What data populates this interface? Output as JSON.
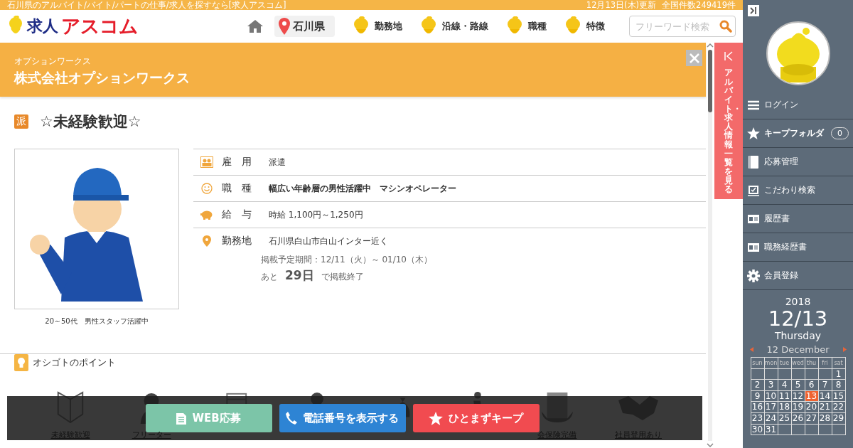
{
  "top_bar": {
    "tagline": "石川県のアルバイト/バイト/パートの仕事/求人を探すなら[求人アスコム]",
    "updated": "12月13日(木)更新",
    "total": "全国件数249419件"
  },
  "header": {
    "logo_kanji": "求人",
    "logo_kana": "アスコム",
    "prefecture": "石川県",
    "search": {
      "placeholder": "フリーワード検索"
    },
    "nav": [
      {
        "label": "勤務地"
      },
      {
        "label": "沿線・路線"
      },
      {
        "label": "職種"
      },
      {
        "label": "特徴"
      }
    ]
  },
  "company": {
    "kana": "オプションワークス",
    "name": "株式会社オプションワークス"
  },
  "job": {
    "type_badge": "派",
    "title": "☆未経験歓迎☆",
    "image_caption": "20～50代　男性スタッフ活躍中",
    "details": [
      {
        "kind": "employment",
        "label": "雇　用",
        "value": "派遣",
        "bold": false
      },
      {
        "kind": "occupation",
        "label": "職　種",
        "value": "幅広い年齢層の男性活躍中　マシンオペレーター",
        "bold": true
      },
      {
        "kind": "salary",
        "label": "給　与",
        "value": "時給 1,100円～1,250円",
        "bold": false
      },
      {
        "kind": "location",
        "label": "勤務地",
        "value": "石川県白山市白山インター近く",
        "bold": false
      }
    ],
    "period": "掲載予定期間：12/11（火）～ 01/10（木）",
    "remaining_prefix": "あと",
    "remaining_days": "29日",
    "remaining_suffix": "で掲載終了"
  },
  "points": {
    "title": "オシゴトのポイント",
    "items": [
      {
        "kind": "beginner",
        "label": "未経験歓迎"
      },
      {
        "kind": "freeter",
        "label": "フリーター"
      },
      {
        "kind": "shift"
      },
      {
        "kind": "student"
      },
      {
        "kind": "money"
      },
      {
        "kind": "bike"
      },
      {
        "kind": "insurance",
        "label": "会保険完備"
      },
      {
        "kind": "handshake",
        "label": "社員登用あり"
      }
    ]
  },
  "action_bar": [
    {
      "kind": "apply",
      "label": "WEB応募"
    },
    {
      "kind": "phone",
      "label": "電話番号を表示する"
    },
    {
      "kind": "keep",
      "label": "ひとまずキープ"
    }
  ],
  "side_tab": {
    "label": "アルバイト・求人情報一覧を見る"
  },
  "sidebar": {
    "items": [
      {
        "kind": "menu",
        "label": "ログイン"
      },
      {
        "kind": "star",
        "label": "キープフォルダ",
        "count": "0"
      },
      {
        "kind": "book",
        "label": "応募管理"
      },
      {
        "kind": "check",
        "label": "こだわり検索"
      },
      {
        "kind": "card",
        "label": "履歴書"
      },
      {
        "kind": "card",
        "label": "職務経歴書"
      },
      {
        "kind": "gear",
        "label": "会員登録"
      }
    ]
  },
  "calendar": {
    "year": "2018",
    "date": "12/13",
    "weekday": "Thursday",
    "month": "12 December",
    "weekdays": [
      "sun",
      "mon",
      "tue",
      "wed",
      "thu",
      "fri",
      "sat"
    ],
    "weeks": [
      [
        {
          "day": "1",
          "selected": false
        }
      ],
      [
        {
          "day": "2",
          "selected": false
        },
        {
          "day": "3",
          "selected": false
        },
        {
          "day": "4",
          "selected": false
        },
        {
          "day": "5",
          "selected": false
        },
        {
          "day": "6",
          "selected": false
        },
        {
          "day": "7",
          "selected": false
        },
        {
          "day": "8",
          "selected": false
        }
      ],
      [
        {
          "day": "9",
          "selected": false
        },
        {
          "day": "10",
          "selected": false
        },
        {
          "day": "11",
          "selected": false
        },
        {
          "day": "12",
          "selected": false
        },
        {
          "day": "13",
          "selected": true
        },
        {
          "day": "14",
          "selected": false
        },
        {
          "day": "15",
          "selected": false
        }
      ],
      [
        {
          "day": "16",
          "selected": false
        },
        {
          "day": "17",
          "selected": false
        },
        {
          "day": "18",
          "selected": false
        },
        {
          "day": "19",
          "selected": false
        },
        {
          "day": "20",
          "selected": false
        },
        {
          "day": "21",
          "selected": false
        },
        {
          "day": "22",
          "selected": false
        }
      ],
      [
        {
          "day": "23",
          "selected": false
        },
        {
          "day": "24",
          "selected": false
        },
        {
          "day": "25",
          "selected": false
        },
        {
          "day": "26",
          "selected": false
        },
        {
          "day": "27",
          "selected": false
        },
        {
          "day": "28",
          "selected": false
        },
        {
          "day": "29",
          "selected": false
        }
      ],
      [
        {
          "day": "30",
          "selected": false
        },
        {
          "day": "31",
          "selected": false
        }
      ]
    ]
  }
}
